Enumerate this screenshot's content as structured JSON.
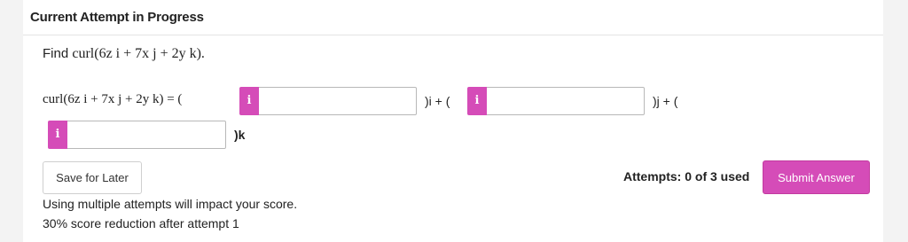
{
  "header": {
    "title": "Current Attempt in Progress"
  },
  "question": {
    "prefix": "Find",
    "expression": "curl(6z i + 7x j + 2y k)."
  },
  "equation": {
    "lhs": "curl(6z i + 7x j + 2y k) = (",
    "sep_i": ")i + (",
    "sep_j": ")j + (",
    "sep_k": ")k",
    "info_glyph": "i",
    "inputs": [
      {
        "value": "",
        "placeholder": ""
      },
      {
        "value": "",
        "placeholder": ""
      },
      {
        "value": "",
        "placeholder": ""
      }
    ]
  },
  "actions": {
    "save_label": "Save for Later",
    "submit_label": "Submit Answer",
    "attempts_text": "Attempts: 0 of 3 used"
  },
  "notes": {
    "line1": "Using multiple attempts will impact your score.",
    "line2": "30% score reduction after attempt 1"
  },
  "colors": {
    "accent": "#d54cb8",
    "page_bg": "#f3f3f3",
    "card_bg": "#ffffff"
  },
  "icons": {
    "info_badge": "info-icon"
  }
}
